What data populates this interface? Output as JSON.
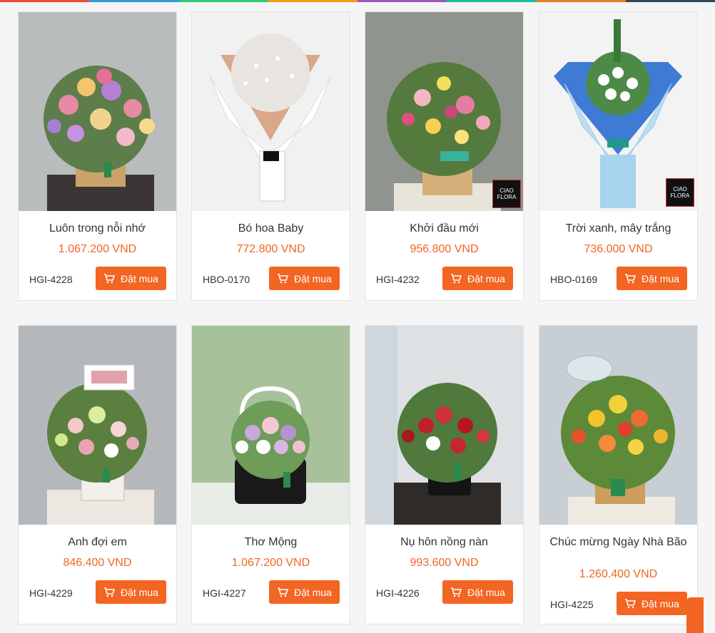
{
  "products": [
    {
      "name": "Luôn trong nỗi nhớ",
      "price": "1.067.200 VND",
      "sku": "HGI-4228",
      "buy": "Đặt mua"
    },
    {
      "name": "Bó hoa Baby",
      "price": "772.800 VND",
      "sku": "HBO-0170",
      "buy": "Đặt mua"
    },
    {
      "name": "Khởi đầu mới",
      "price": "956.800 VND",
      "sku": "HGI-4232",
      "buy": "Đặt mua"
    },
    {
      "name": "Trời xanh, mây trắng",
      "price": "736.000 VND",
      "sku": "HBO-0169",
      "buy": "Đặt mua"
    },
    {
      "name": "Anh đợi em",
      "price": "846.400 VND",
      "sku": "HGI-4229",
      "buy": "Đặt mua"
    },
    {
      "name": "Thơ Mộng",
      "price": "1.067.200 VND",
      "sku": "HGI-4227",
      "buy": "Đặt mua"
    },
    {
      "name": "Nụ hôn nồng nàn",
      "price": "993.600 VND",
      "sku": "HGI-4226",
      "buy": "Đặt mua"
    },
    {
      "name": "Chúc mừng Ngày Nhà Bão",
      "price": "1.260.400 VND",
      "sku": "HGI-4225",
      "buy": "Đặt mua"
    }
  ],
  "badge": {
    "line1": "CIAO",
    "line2": "FLORA"
  },
  "colors": {
    "accent": "#f26522",
    "text": "#333333",
    "border": "#e3e3e3"
  }
}
